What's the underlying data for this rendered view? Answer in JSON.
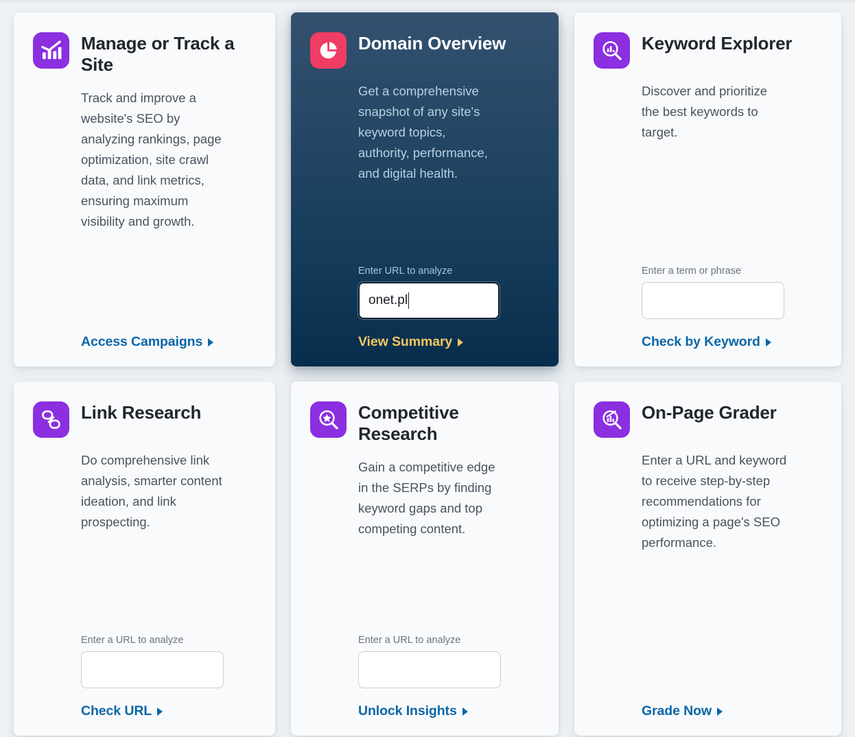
{
  "page": {
    "background_color": "#eef1f4",
    "accent_link_color": "#0a66a8",
    "featured_link_color": "#f0c661",
    "icon_purple": "#8b2fe0",
    "icon_pink": "#ef3d63"
  },
  "cards": [
    {
      "id": "manage-or-track-a-site",
      "icon_name": "bar-chart-trend-icon",
      "icon_color": "#8b2fe0",
      "title": "Manage or Track a Site",
      "description": "Track and improve a website's SEO by analyzing rankings, page optimization, site crawl data, and link metrics, ensuring maximum visibility and growth.",
      "has_input": false,
      "input_label": "",
      "input_value": "",
      "cta_label": "Access Campaigns",
      "featured": false
    },
    {
      "id": "domain-overview",
      "icon_name": "pie-chart-icon",
      "icon_color": "#ef3d63",
      "title": "Domain Overview",
      "description": "Get a comprehensive snapshot of any site's keyword topics, authority, performance, and digital health.",
      "has_input": true,
      "input_label": "Enter URL to analyze",
      "input_value": "onet.pl",
      "input_placeholder": "",
      "cta_label": "View Summary",
      "featured": true
    },
    {
      "id": "keyword-explorer",
      "icon_name": "magnifier-bar-chart-icon",
      "icon_color": "#8b2fe0",
      "title": "Keyword Explorer",
      "description": "Discover and prioritize the best keywords to target.",
      "has_input": true,
      "input_label": "Enter a term or phrase",
      "input_value": "",
      "input_placeholder": "",
      "cta_label": "Check by Keyword",
      "featured": false
    },
    {
      "id": "link-research",
      "icon_name": "chain-link-icon",
      "icon_color": "#8b2fe0",
      "title": "Link Research",
      "description": "Do comprehensive link analysis, smarter content ideation, and link prospecting.",
      "has_input": true,
      "input_label": "Enter a URL to analyze",
      "input_value": "",
      "input_placeholder": "",
      "cta_label": "Check URL",
      "featured": false
    },
    {
      "id": "competitive-research",
      "icon_name": "magnifier-star-icon",
      "icon_color": "#8b2fe0",
      "title": "Competitive Research",
      "description": "Gain a competitive edge in the SERPs by finding keyword gaps and top competing content.",
      "has_input": true,
      "input_label": "Enter a URL to analyze",
      "input_value": "",
      "input_placeholder": "",
      "cta_label": "Unlock Insights",
      "featured": false
    },
    {
      "id": "on-page-grader",
      "icon_name": "magnifier-page-chart-icon",
      "icon_color": "#8b2fe0",
      "title": "On-Page Grader",
      "description": "Enter a URL and keyword to receive step-by-step recommendations for optimizing a page's SEO performance.",
      "has_input": false,
      "input_label": "",
      "input_value": "",
      "cta_label": "Grade Now",
      "featured": false
    }
  ]
}
